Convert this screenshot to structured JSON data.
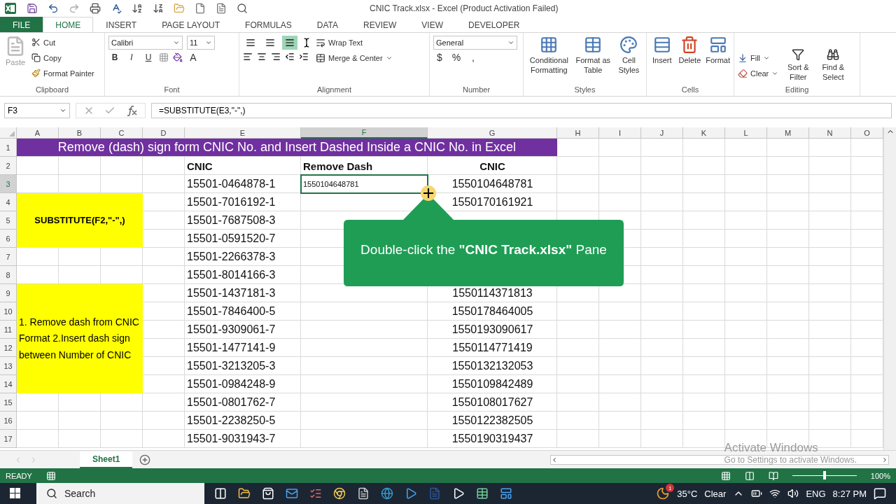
{
  "window": {
    "title": "CNIC Track.xlsx - Excel (Product Activation Failed)"
  },
  "ribbon_tabs": [
    {
      "label": "FILE",
      "kind": "file",
      "selected": false
    },
    {
      "label": "HOME",
      "kind": "tab",
      "selected": true
    },
    {
      "label": "INSERT",
      "kind": "tab",
      "selected": false
    },
    {
      "label": "PAGE LAYOUT",
      "kind": "tab",
      "selected": false
    },
    {
      "label": "FORMULAS",
      "kind": "tab",
      "selected": false
    },
    {
      "label": "DATA",
      "kind": "tab",
      "selected": false
    },
    {
      "label": "REVIEW",
      "kind": "tab",
      "selected": false
    },
    {
      "label": "VIEW",
      "kind": "tab",
      "selected": false
    },
    {
      "label": "DEVELOPER",
      "kind": "tab",
      "selected": false
    }
  ],
  "clipboard": {
    "label": "Clipboard",
    "paste": "Paste",
    "cut": "Cut",
    "copy": "Copy",
    "format_painter": "Format Painter"
  },
  "font": {
    "label": "Font",
    "name": "Calibri",
    "size": "11",
    "styles": [
      "B",
      "I",
      "U"
    ],
    "color_button": "A"
  },
  "alignment": {
    "label": "Alignment",
    "valign": [
      {
        "selected": false
      },
      {
        "selected": false
      },
      {
        "selected": true
      }
    ],
    "wrap_text": "Wrap Text",
    "merge_center": "Merge & Center"
  },
  "number": {
    "label": "Number",
    "format": "General",
    "symbols": [
      "$",
      "%",
      ","
    ]
  },
  "styles": {
    "label": "Styles",
    "buttons": [
      "Conditional Formatting",
      "Format as Table",
      "Cell Styles"
    ]
  },
  "cells": {
    "label": "Cells",
    "buttons": [
      "Insert",
      "Delete",
      "Format"
    ]
  },
  "editing": {
    "label": "Editing",
    "fill": "Fill",
    "clear": "Clear",
    "buttons": [
      "Sort & Filter",
      "Find & Select"
    ]
  },
  "formula_bar": {
    "name_box": "F3",
    "formula": "=SUBSTITUTE(E3,\"-\",)"
  },
  "sheet": {
    "columns": [
      {
        "label": "A",
        "selected": false
      },
      {
        "label": "B",
        "selected": false
      },
      {
        "label": "C",
        "selected": false
      },
      {
        "label": "D",
        "selected": false
      },
      {
        "label": "E",
        "selected": false
      },
      {
        "label": "F",
        "selected": true
      },
      {
        "label": "G",
        "selected": false
      },
      {
        "label": "H",
        "selected": false
      },
      {
        "label": "I",
        "selected": false
      },
      {
        "label": "J",
        "selected": false
      },
      {
        "label": "K",
        "selected": false
      },
      {
        "label": "L",
        "selected": false
      },
      {
        "label": "M",
        "selected": false
      },
      {
        "label": "N",
        "selected": false
      },
      {
        "label": "O",
        "selected": false
      }
    ],
    "row_numbers": [
      {
        "label": "1",
        "selected": false
      },
      {
        "label": "2",
        "selected": false
      },
      {
        "label": "3",
        "selected": true
      },
      {
        "label": "4",
        "selected": false
      },
      {
        "label": "5",
        "selected": false
      },
      {
        "label": "6",
        "selected": false
      },
      {
        "label": "7",
        "selected": false
      },
      {
        "label": "8",
        "selected": false
      },
      {
        "label": "9",
        "selected": false
      },
      {
        "label": "10",
        "selected": false
      },
      {
        "label": "11",
        "selected": false
      },
      {
        "label": "12",
        "selected": false
      },
      {
        "label": "13",
        "selected": false
      },
      {
        "label": "14",
        "selected": false
      },
      {
        "label": "15",
        "selected": false
      },
      {
        "label": "16",
        "selected": false
      },
      {
        "label": "17",
        "selected": false
      }
    ],
    "title": "Remove (dash) sign form CNIC No. and Insert Dashed Inside a CNIC No. in Excel",
    "notes": [
      "SUBSTITUTE(F2,\"-\",)",
      "1. Remove dash from CNIC Format 2.Insert dash sign between Number of CNIC"
    ],
    "headers": [
      "CNIC",
      "Remove Dash",
      "CNIC"
    ],
    "rows": [
      {
        "cnic": "15501-0464878-1",
        "no_dash": "1550104648781",
        "plain": "1550104648781",
        "selected": true
      },
      {
        "cnic": "15501-7016192-1",
        "plain": "1550170161921",
        "selected": false
      },
      {
        "cnic": "15501-7687508-3",
        "selected": false
      },
      {
        "cnic": "15501-0591520-7",
        "selected": false
      },
      {
        "cnic": "15501-2266378-3",
        "selected": false
      },
      {
        "cnic": "15501-8014166-3",
        "selected": false
      },
      {
        "cnic": "15501-1437181-3",
        "plain": "1550114371813",
        "selected": false
      },
      {
        "cnic": "15501-7846400-5",
        "plain": "1550178464005",
        "selected": false
      },
      {
        "cnic": "15501-9309061-7",
        "plain": "1550193090617",
        "selected": false
      },
      {
        "cnic": "15501-1477141-9",
        "plain": "1550114771419",
        "selected": false
      },
      {
        "cnic": "15501-3213205-3",
        "plain": "1550132132053",
        "selected": false
      },
      {
        "cnic": "15501-0984248-9",
        "plain": "1550109842489",
        "selected": false
      },
      {
        "cnic": "15501-0801762-7",
        "plain": "1550108017627",
        "selected": false
      },
      {
        "cnic": "15501-2238250-5",
        "plain": "1550122382505",
        "selected": false
      },
      {
        "cnic": "15501-9031943-7",
        "plain": "1550190319437",
        "selected": false
      }
    ],
    "sheet_tabs": [
      {
        "label": "Sheet1",
        "selected": true
      }
    ]
  },
  "callout": {
    "text": "Double-click the **\"CNIC Track.xlsx\"** Pane"
  },
  "activation": {
    "title": "Activate Windows",
    "message": "Go to Settings to activate Windows."
  },
  "status_bar": {
    "mode": "READY",
    "zoom": {
      "level": 0.5
    },
    "zoom_label": "100%"
  },
  "taskbar": {
    "search": "Search",
    "temperature": "35°C",
    "weather": "Clear",
    "language": "ENG",
    "time": "8:27 PM",
    "weather_badge": "1"
  }
}
